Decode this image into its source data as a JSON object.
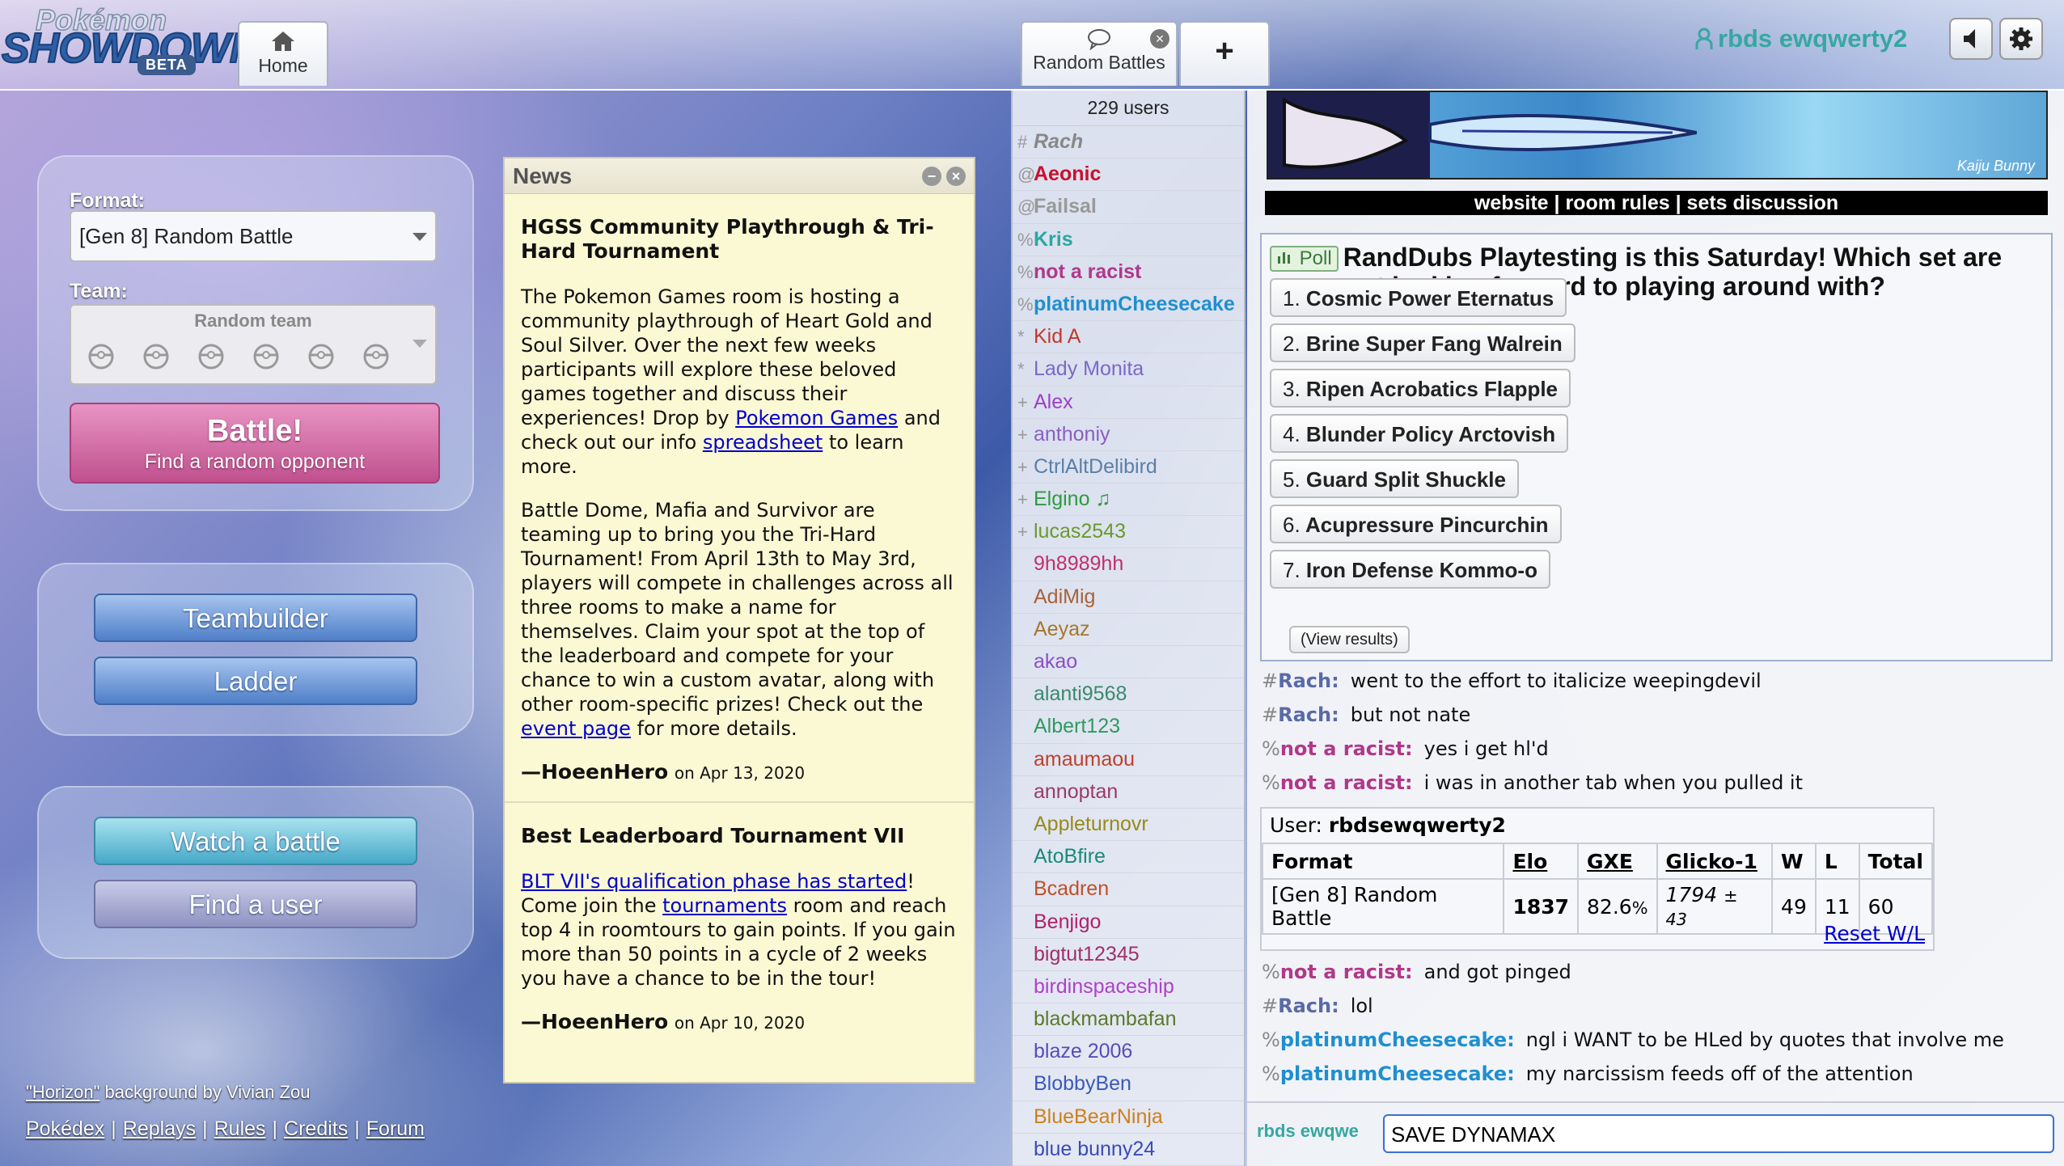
{
  "header": {
    "logo": {
      "line1": "Pokémon",
      "line2": "SHOWDOWN",
      "badge": "BETA"
    },
    "tabs": [
      {
        "label": "Home",
        "icon": "home-icon"
      },
      {
        "label": "Random Battles",
        "icon": "chat-bubble-icon"
      }
    ],
    "new_tab_label": "+",
    "close_glyph": "×",
    "username": "rbds ewqwerty2"
  },
  "menu": {
    "format_label": "Format:",
    "format_value": "[Gen 8] Random Battle",
    "team_label": "Team:",
    "team_value": "Random team",
    "battle_label": "Battle!",
    "battle_sub": "Find a random opponent",
    "teambuilder": "Teambuilder",
    "ladder": "Ladder",
    "watch": "Watch a battle",
    "find_user": "Find a user"
  },
  "credit": {
    "link": "\"Horizon\"",
    "text": " background by Vivian Zou"
  },
  "footer": [
    "Pokédex",
    "Replays",
    "Rules",
    "Credits",
    "Forum"
  ],
  "footer_sep": "|",
  "news": {
    "title": "News",
    "min_glyph": "−",
    "close_glyph": "×",
    "items": [
      {
        "title": "HGSS Community Playthrough & Tri-Hard Tournament",
        "p1_a": "The Pokemon Games room is hosting a community playthrough of Heart Gold and Soul Silver. Over the next few weeks participants will explore these beloved games together and discuss their experiences! Drop by ",
        "p1_link1": "Pokemon Games",
        "p1_b": " and check out our info ",
        "p1_link2": "spreadsheet",
        "p1_c": " to learn more.",
        "p2_a": "Battle Dome, Mafia and Survivor are teaming up to bring you the Tri-Hard Tournament! From April 13th to May 3rd, players will compete in challenges across all three rooms to make a name for themselves. Claim your spot at the top of the leaderboard and compete for your chance to win a custom avatar, along with other room-specific prizes! Check out the ",
        "p2_link": "event page",
        "p2_b": " for more details.",
        "author": "—HoeenHero",
        "date": "on Apr 13, 2020"
      },
      {
        "title": "Best Leaderboard Tournament VII",
        "p1_link1": "BLT VII's qualification phase has started",
        "p1_a": "! Come join the ",
        "p1_link2": "tournaments",
        "p1_b": " room and reach top 4 in roomtours to gain points. If you gain more than 50 points in a cycle of 2 weeks you have a chance to be in the tour!",
        "author": "—HoeenHero",
        "date": "on Apr 10, 2020"
      }
    ]
  },
  "userlist": {
    "count": "229 users",
    "users": [
      {
        "rank": "#",
        "name": "Rach",
        "color": "#888888",
        "style": "italic-bold"
      },
      {
        "rank": "@",
        "name": "Aeonic",
        "color": "#c8102e",
        "style": "bold"
      },
      {
        "rank": "@",
        "name": "Failsal",
        "color": "#999999",
        "style": "bold"
      },
      {
        "rank": "%",
        "name": "Kris",
        "color": "#2aa8a0",
        "style": "bold"
      },
      {
        "rank": "%",
        "name": "not a racist",
        "color": "#b0388a",
        "style": "bold"
      },
      {
        "rank": "%",
        "name": "platinumCheesecake",
        "color": "#1e8fd0",
        "style": "bold"
      },
      {
        "rank": "*",
        "name": "Kid A",
        "color": "#c0392b",
        "style": ""
      },
      {
        "rank": "*",
        "name": "Lady Monita",
        "color": "#7b68c8",
        "style": ""
      },
      {
        "rank": "+",
        "name": "Alex",
        "color": "#9b3fc8",
        "style": ""
      },
      {
        "rank": "+",
        "name": "anthoniy",
        "color": "#8a5fc0",
        "style": ""
      },
      {
        "rank": "+",
        "name": "CtrlAltDelibird",
        "color": "#5a7fa8",
        "style": ""
      },
      {
        "rank": "+",
        "name": "Elgino ♫",
        "color": "#2e9a3e",
        "style": ""
      },
      {
        "rank": "+",
        "name": "lucas2543",
        "color": "#6a9a2a",
        "style": ""
      },
      {
        "rank": "",
        "name": "9h8989hh",
        "color": "#c0306a",
        "style": ""
      },
      {
        "rank": "",
        "name": "AdiMig",
        "color": "#a8623a",
        "style": ""
      },
      {
        "rank": "",
        "name": "Aeyaz",
        "color": "#a8762a",
        "style": ""
      },
      {
        "rank": "",
        "name": "akao",
        "color": "#8a4fc8",
        "style": ""
      },
      {
        "rank": "",
        "name": "alanti9568",
        "color": "#3a8a6a",
        "style": ""
      },
      {
        "rank": "",
        "name": "Albert123",
        "color": "#2e9a5e",
        "style": ""
      },
      {
        "rank": "",
        "name": "amaumaou",
        "color": "#c0402a",
        "style": ""
      },
      {
        "rank": "",
        "name": "annoptan",
        "color": "#9a3a6a",
        "style": ""
      },
      {
        "rank": "",
        "name": "Appleturnovr",
        "color": "#9a8a1a",
        "style": ""
      },
      {
        "rank": "",
        "name": "AtoBfire",
        "color": "#1a8a7a",
        "style": ""
      },
      {
        "rank": "",
        "name": "Bcadren",
        "color": "#c0502a",
        "style": ""
      },
      {
        "rank": "",
        "name": "Benjigo",
        "color": "#b0206a",
        "style": ""
      },
      {
        "rank": "",
        "name": "bigtut12345",
        "color": "#a0306a",
        "style": ""
      },
      {
        "rank": "",
        "name": "birdinspaceship",
        "color": "#b040c8",
        "style": ""
      },
      {
        "rank": "",
        "name": "blackmambafan",
        "color": "#5a7a2a",
        "style": ""
      },
      {
        "rank": "",
        "name": "blaze 2006",
        "color": "#5a4ab8",
        "style": ""
      },
      {
        "rank": "",
        "name": "BlobbyBen",
        "color": "#3a5ab8",
        "style": ""
      },
      {
        "rank": "",
        "name": "BlueBearNinja",
        "color": "#d0801a",
        "style": ""
      },
      {
        "rank": "",
        "name": "blue bunny24",
        "color": "#3a4ab8",
        "style": ""
      }
    ]
  },
  "chat": {
    "banner_credit": "Kaiju Bunny",
    "banner_links": "website | room rules | sets discussion",
    "poll": {
      "badge": "Poll",
      "question": "RandDubs Playtesting is this Saturday! Which set are you most looking forward to playing around with?",
      "options": [
        {
          "n": "1.",
          "label": "Cosmic Power Eternatus"
        },
        {
          "n": "2.",
          "label": "Brine Super Fang Walrein"
        },
        {
          "n": "3.",
          "label": "Ripen Acrobatics Flapple"
        },
        {
          "n": "4.",
          "label": "Blunder Policy Arctovish"
        },
        {
          "n": "5.",
          "label": "Guard Split Shuckle"
        },
        {
          "n": "6.",
          "label": "Acupressure Pincurchin"
        },
        {
          "n": "7.",
          "label": "Iron Defense Kommo-o"
        }
      ],
      "view_results": "(View results)"
    },
    "messages_before": [
      {
        "rank": "#",
        "name": "Rach:",
        "color": "#5a6aa8",
        "text": "went to the effort to italicize weepingdevil"
      },
      {
        "rank": "#",
        "name": "Rach:",
        "color": "#5a6aa8",
        "text": "but not nate"
      },
      {
        "rank": "%",
        "name": "not a racist:",
        "color": "#b0388a",
        "text": "yes i get hl'd"
      },
      {
        "rank": "%",
        "name": "not a racist:",
        "color": "#b0388a",
        "text": "i was in another tab when you pulled it"
      }
    ],
    "rank_box": {
      "user_label": "User:",
      "user": "rbdsewqwerty2",
      "headers": [
        "Format",
        "Elo",
        "GXE",
        "Glicko-1",
        "W",
        "L",
        "Total"
      ],
      "row": {
        "format": "[Gen 8] Random Battle",
        "elo": "1837",
        "gxe": "82.6",
        "gxe_unit": "%",
        "glicko": "1794",
        "glicko_dev": "± 43",
        "w": "49",
        "l": "11",
        "total": "60"
      },
      "reset": "Reset W/L"
    },
    "messages_after": [
      {
        "rank": "%",
        "name": "not a racist:",
        "color": "#b0388a",
        "text": "and got pinged"
      },
      {
        "rank": "#",
        "name": "Rach:",
        "color": "#5a6aa8",
        "text": "lol"
      },
      {
        "rank": "%",
        "name": "platinumCheesecake:",
        "color": "#1e8fd0",
        "text": "ngl i WANT to be HLed by quotes that involve me"
      },
      {
        "rank": "%",
        "name": "platinumCheesecake:",
        "color": "#1e8fd0",
        "text": "my narcissism feeds off of the attention"
      }
    ],
    "input_name": "rbds ewqwe",
    "input_value": "SAVE DYNAMAX"
  }
}
